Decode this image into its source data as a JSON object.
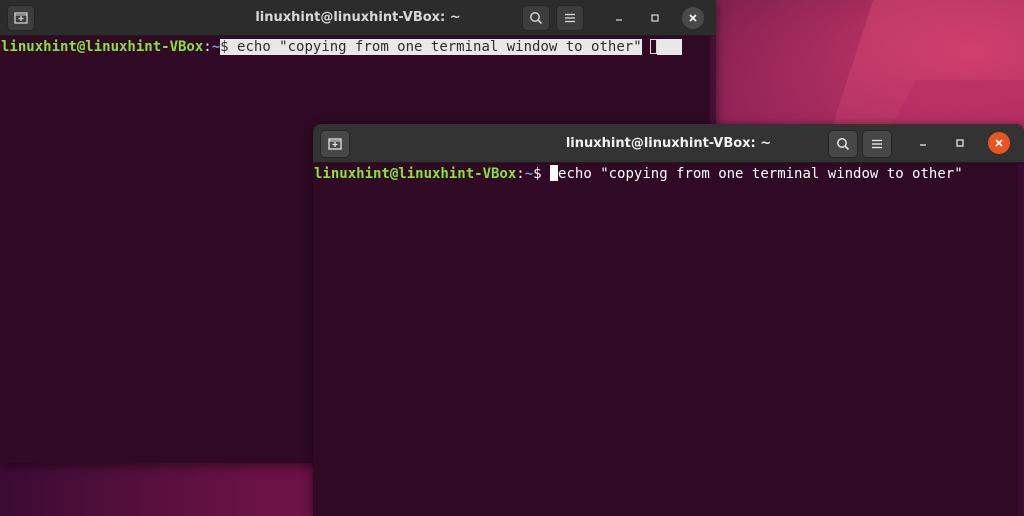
{
  "back_window": {
    "title": "linuxhint@linuxhint-VBox: ~",
    "prompt": {
      "user_host": "linuxhint@linuxhint-VBox",
      "colon": ":",
      "path": "~",
      "dollar": "$"
    },
    "command_selected": " echo \"copying from one terminal window to other\"",
    "trailing": " "
  },
  "front_window": {
    "title": "linuxhint@linuxhint-VBox: ~",
    "prompt": {
      "user_host": "linuxhint@linuxhint-VBox",
      "colon": ":",
      "path": "~",
      "dollar": "$"
    },
    "command": "echo \"copying from one terminal window to other\""
  },
  "icons": {
    "new_tab": "new-tab-icon",
    "search": "search-icon",
    "menu": "hamburger-menu-icon",
    "minimize": "minimize-icon",
    "maximize": "maximize-icon",
    "close": "close-icon"
  },
  "colors": {
    "terminal_bg": "#300a24",
    "prompt_user": "#8ae234",
    "prompt_path": "#729fcf",
    "close_active": "#e95420"
  }
}
